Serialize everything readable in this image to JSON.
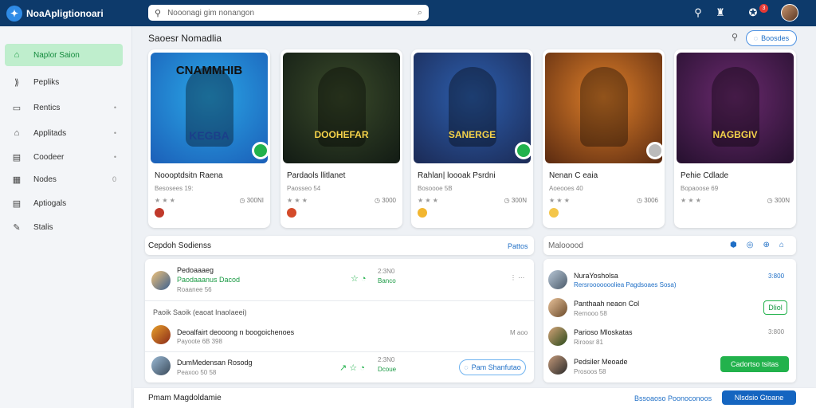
{
  "app": {
    "title": "NoaApligtionoari",
    "logo_glyph": "✦"
  },
  "search": {
    "placeholder": "Nooonagi gim nonangon",
    "icon": "search-icon",
    "camera_icon": "camera-icon"
  },
  "topbar": {
    "icons": [
      "search-icon",
      "bell-icon",
      "notification-icon",
      "profile-avatar"
    ],
    "notification_count": "3"
  },
  "sidebar": {
    "items": [
      {
        "label": "Naplor Saion",
        "icon": "home-icon",
        "glyph": "⌂",
        "active": true,
        "dot": ""
      },
      {
        "label": "Pepliks",
        "icon": "paper-plane-icon",
        "glyph": "⟫",
        "active": false,
        "dot": ""
      },
      {
        "label": "Rentics",
        "icon": "folder-icon",
        "glyph": "▭",
        "active": false,
        "dot": "•"
      },
      {
        "label": "Applitads",
        "icon": "apps-icon",
        "glyph": "⌂",
        "active": false,
        "dot": "•"
      },
      {
        "label": "Coodeer",
        "icon": "book-icon",
        "glyph": "▤",
        "active": false,
        "dot": "•"
      },
      {
        "label": "Nodes",
        "icon": "calendar-icon",
        "glyph": "▦",
        "active": false,
        "dot": "0"
      },
      {
        "label": "Aptiogals",
        "icon": "archive-icon",
        "glyph": "▤",
        "active": false,
        "dot": ""
      },
      {
        "label": "Stalis",
        "icon": "pen-icon",
        "glyph": "✎",
        "active": false,
        "dot": ""
      }
    ]
  },
  "featured": {
    "title": "Saoesr Nomadlia",
    "button_label": "Boosdes",
    "cards": [
      {
        "art_text": "CNAMMHIB",
        "art_text2": "KEGBA",
        "title": "Noooptdsitn Raena",
        "sub": "Besosees 19:",
        "stars": "★ ★ ★",
        "count": "◷ 300NI",
        "colors": [
          "#2aa6e6",
          "#1b5fb8"
        ],
        "mini": "#c0392b",
        "badge": "green"
      },
      {
        "art_text": "DOOHEFAR",
        "art_text2": "",
        "title": "Pardaols llitlanet",
        "sub": "Paosseo 54",
        "stars": "★ ★ ★",
        "count": "◷ 3000",
        "colors": [
          "#3a4a2a",
          "#121b14"
        ],
        "mini": "#d44b2a",
        "badge": ""
      },
      {
        "art_text": "SANERGE",
        "art_text2": "",
        "title": "Rahlan| loooak Psrdni",
        "sub": "Bosoooe 5B",
        "stars": "★ ★ ★",
        "count": "◷ 300N",
        "colors": [
          "#2d5fae",
          "#1b2a55"
        ],
        "mini": "#f2b630",
        "badge": "green"
      },
      {
        "art_text": "",
        "art_text2": "",
        "title": "Nenan C eaia",
        "sub": "Aoeooes 40",
        "stars": "★ ★ ★",
        "count": "◷ 3006",
        "colors": [
          "#e0802a",
          "#5a2a10"
        ],
        "mini": "#f4c64a",
        "badge": "gray"
      },
      {
        "art_text": "NAGBGIV",
        "art_text2": "",
        "title": "Pehie Cdlade",
        "sub": "Bopaoose 69",
        "stars": "★ ★ ★",
        "count": "◷ 300N",
        "colors": [
          "#6a2a6e",
          "#25102e"
        ],
        "mini": "",
        "badge": ""
      }
    ]
  },
  "left_panel": {
    "title": "Cepdoh Sodienss",
    "link": "Pattos",
    "rows": [
      {
        "title": "Pedoaaaeg",
        "green": "Paodaaanus Dacod",
        "sub": "Roaanee 56",
        "meta1": "2:3N0",
        "meta2": "Banco",
        "meta_green": true,
        "icons": "☆ ◔",
        "trail": "⋮ ⋯"
      },
      {
        "title": "Deoalfairt deooong n boogoichenoes",
        "green": "",
        "sub": "Payoote 6B 398",
        "meta1": "",
        "meta2": "",
        "meta_green": false,
        "icons": "",
        "trail": "M aoo"
      },
      {
        "title": "DumMedensan Rosodg",
        "green": "",
        "sub": "Peaxoo 50 58",
        "meta1": "2:3N0",
        "meta2": "Dcoue",
        "meta_green": true,
        "icons": "↗ ☆ ◔",
        "trail": ""
      }
    ],
    "subheading": "Paoik Saoik (eaoat Inaolaeei)",
    "action_label": "Pam Shanfutao"
  },
  "right_panel": {
    "title": "Malooood",
    "rows": [
      {
        "title": "NuraYosholsa",
        "sub": "Rersroooooooliea Pagdsoaes Sosa)",
        "meta": "3:800",
        "sub_blue": true
      },
      {
        "title": "Panthaah neaon Col",
        "sub": "Rernooo 58",
        "meta": "",
        "sub_blue": false,
        "btn": "Dliol"
      },
      {
        "title": "Parioso Mloskatas",
        "sub": "Riroosr 81",
        "meta": "3:800",
        "sub_blue": false
      },
      {
        "title": "Pedsiler Meoade",
        "sub": "Prosoos 58",
        "meta": "",
        "sub_blue": false,
        "btn": "Cadortso tsitas"
      }
    ]
  },
  "footer": {
    "title": "Pmam Magdoldamie",
    "link": "Bssoaoso Poonoconoos",
    "button_label": "Nlsdsio Gtoane"
  }
}
